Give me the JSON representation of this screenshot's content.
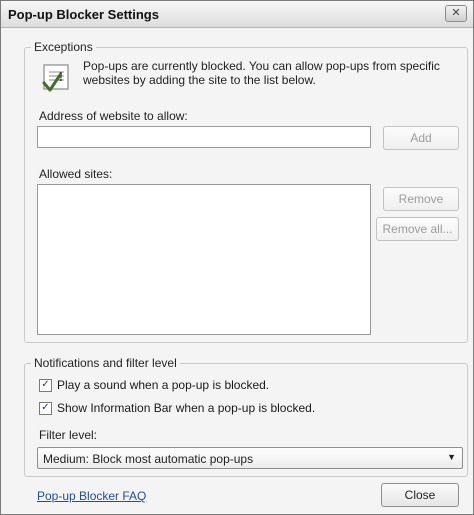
{
  "window": {
    "title": "Pop-up Blocker Settings",
    "close_glyph": "✕"
  },
  "exceptions": {
    "legend": "Exceptions",
    "info_icon": "checklist-icon",
    "info_text": "Pop-ups are currently blocked.  You can allow pop-ups from specific websites by adding the site to the list below.",
    "address_label": "Address of website to allow:",
    "address_value": "",
    "add_button": "Add",
    "allowed_label": "Allowed sites:",
    "allowed_sites": [],
    "remove_button": "Remove",
    "remove_all_button": "Remove all..."
  },
  "notifications": {
    "legend": "Notifications and filter level",
    "play_sound": {
      "label": "Play a sound when a pop-up is blocked.",
      "checked": true
    },
    "show_info_bar": {
      "label": "Show Information Bar when a pop-up is blocked.",
      "checked": true
    },
    "filter_label": "Filter level:",
    "filter_selected": "Medium: Block most automatic pop-ups"
  },
  "footer": {
    "faq_link": "Pop-up Blocker FAQ",
    "close_button": "Close"
  },
  "colors": {
    "link": "#1f4e9b",
    "disabled_text": "#9c9c9c"
  }
}
